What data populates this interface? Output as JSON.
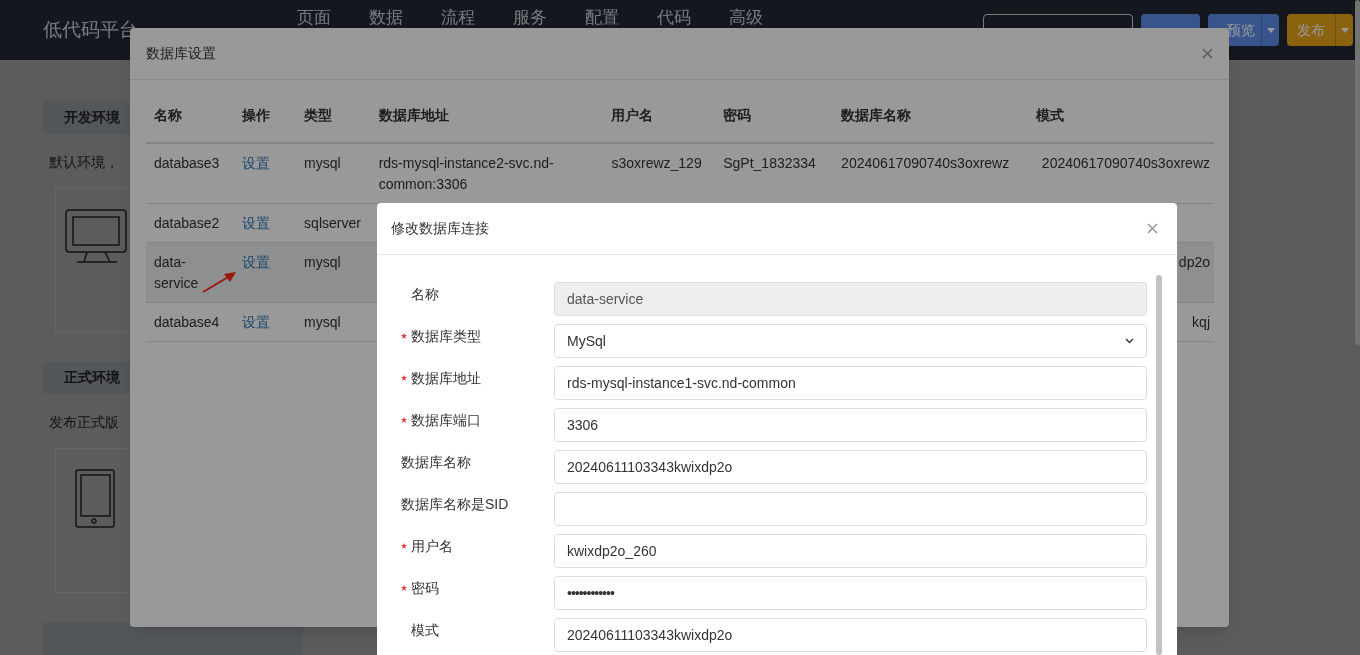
{
  "topbar": {
    "title": "低代码平台",
    "nav": [
      "页面",
      "数据",
      "流程",
      "服务",
      "配置",
      "代码",
      "高级"
    ],
    "buttons": [
      {
        "label": "预览",
        "kind": "primary"
      },
      {
        "label": "发布",
        "kind": "warning"
      }
    ]
  },
  "page": {
    "sections": [
      {
        "title": "开发环境",
        "text": "默认环境，",
        "kind": "monitor"
      },
      {
        "title": "正式环境",
        "text": "发布正式版",
        "kind": "tablet"
      },
      {
        "kind": "header"
      }
    ]
  },
  "db_dialog": {
    "title": "数据库设置",
    "columns": [
      "名称",
      "操作",
      "类型",
      "数据库地址",
      "用户名",
      "密码",
      "数据库名称",
      "模式"
    ],
    "rows": [
      {
        "selected": false,
        "cells": [
          "database3",
          "设置",
          "mysql",
          "rds-mysql-instance2-svc.nd-common:3306",
          "s3oxrewz_129",
          "SgPt_1832334",
          "20240617090740s3oxrewz",
          "20240617090740s3oxrewz"
        ]
      },
      {
        "selected": false,
        "cells": [
          "database2",
          "设置",
          "sqlserver"
        ]
      },
      {
        "selected": true,
        "cells": [
          "data-service",
          "设置",
          "mysql",
          null,
          null,
          null,
          null,
          "dp2o"
        ]
      },
      {
        "selected": false,
        "cells": [
          "database4",
          "设置",
          "mysql",
          null,
          null,
          null,
          null,
          "kqj"
        ]
      }
    ]
  },
  "edit_dialog": {
    "title": "修改数据库连接",
    "fields": [
      {
        "label": "名称",
        "kind": "text",
        "required": false,
        "disabled": true,
        "value": "data-service"
      },
      {
        "label": "数据库类型",
        "kind": "select",
        "required": true,
        "disabled": false,
        "value": "MySql"
      },
      {
        "label": "数据库地址",
        "kind": "text",
        "required": true,
        "disabled": false,
        "value": "rds-mysql-instance1-svc.nd-common"
      },
      {
        "label": "数据库端口",
        "kind": "text",
        "required": true,
        "disabled": false,
        "value": "3306"
      },
      {
        "label": "数据库名称",
        "kind": "text",
        "required": false,
        "disabled": false,
        "value": "20240611103343kwixdp2o"
      },
      {
        "label": "数据库名称是SID",
        "kind": "text",
        "required": false,
        "disabled": false
      },
      {
        "label": "用户名",
        "kind": "text",
        "required": true,
        "disabled": false,
        "value": "kwixdp2o_260"
      },
      {
        "label": "密码",
        "kind": "password",
        "required": true,
        "disabled": false,
        "value": "••••••••••••"
      },
      {
        "label": "模式",
        "kind": "text",
        "required": false,
        "disabled": false,
        "value": "20240611103343kwixdp2o"
      }
    ]
  }
}
